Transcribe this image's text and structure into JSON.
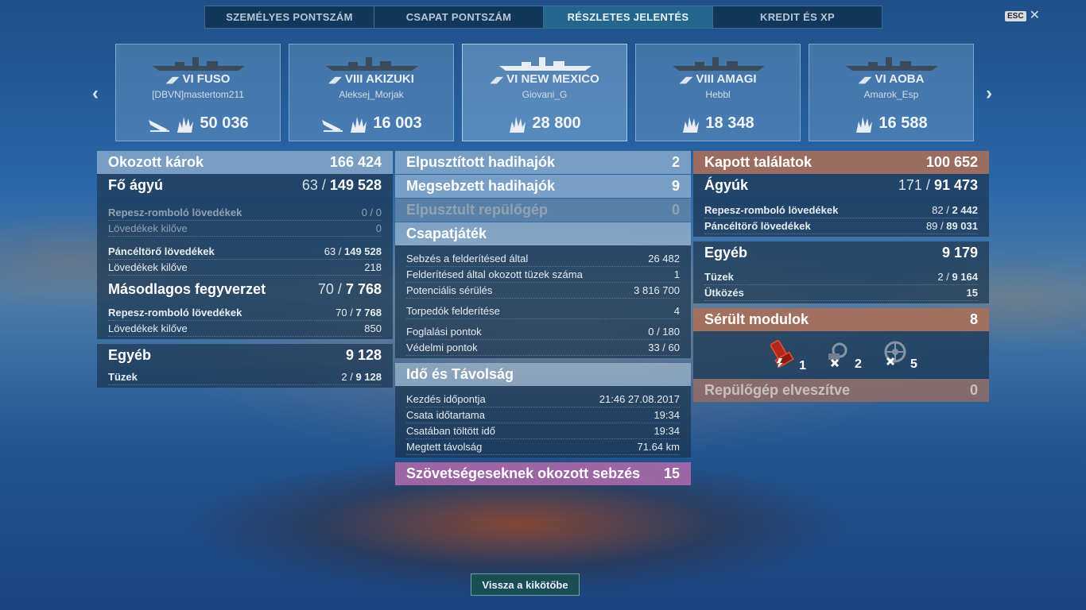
{
  "tabs": [
    "SZEMÉLYES PONTSZÁM",
    "CSAPAT PONTSZÁM",
    "RÉSZLETES JELENTÉS",
    "KREDIT ÉS XP"
  ],
  "active_tab": "RÉSZLETES JELENTÉS",
  "esc": {
    "key": "ESC",
    "close": "✕"
  },
  "arrows": {
    "left": "‹",
    "right": "›"
  },
  "cards": [
    {
      "tier": "VI",
      "ship": "FUSO",
      "player": "[DBVN]mastertom211",
      "score": "50 036"
    },
    {
      "tier": "VIII",
      "ship": "AKIZUKI",
      "player": "Aleksej_Morjak",
      "score": "16 003"
    },
    {
      "tier": "VI",
      "ship": "NEW MEXICO",
      "player": "Giovani_G",
      "score": "28 800"
    },
    {
      "tier": "VIII",
      "ship": "AMAGI",
      "player": "Hebbl",
      "score": "18 348"
    },
    {
      "tier": "VI",
      "ship": "AOBA",
      "player": "Amarok_Esp",
      "score": "16 588"
    }
  ],
  "damage": {
    "title": "Okozott károk",
    "total": "166 424",
    "main": {
      "title": "Fő ágyú",
      "hits": "63",
      "sep": "/",
      "shots": "149 528"
    },
    "he": {
      "label": "Repesz-romboló lövedékek",
      "value": "0 / 0"
    },
    "he_fired": {
      "label": "Lövedékek kilőve",
      "value": "0"
    },
    "ap": {
      "label": "Páncéltörő lövedékek",
      "hits": "63 / ",
      "dmg": "149 528"
    },
    "ap_fired": {
      "label": "Lövedékek kilőve",
      "value": "218"
    },
    "secondary": {
      "title": "Másodlagos fegyverzet",
      "hits": "70",
      "sep": "/",
      "dmg": "7 768"
    },
    "sec_he": {
      "label": "Repesz-romboló lövedékek",
      "hits": "70 / ",
      "dmg": "7 768"
    },
    "sec_fired": {
      "label": "Lövedékek kilőve",
      "value": "850"
    },
    "other": {
      "title": "Egyéb",
      "value": "9 128"
    },
    "fires": {
      "label": "Tüzek",
      "hits": "2 / ",
      "dmg": "9 128"
    }
  },
  "middle": {
    "destroyed": {
      "label": "Elpusztított hadihajók",
      "value": "2"
    },
    "damaged": {
      "label": "Megsebzett hadihajók",
      "value": "9"
    },
    "planes": {
      "label": "Elpusztult repülőgép",
      "value": "0"
    },
    "team": {
      "title": "Csapatjáték",
      "rows": [
        {
          "label": "Sebzés a felderítésed által",
          "value": "26 482"
        },
        {
          "label": "Felderítésed által okozott tüzek száma",
          "value": "1"
        },
        {
          "label": "Potenciális sérülés",
          "value": "3 816 700"
        },
        {
          "label": "Torpedók felderítése",
          "value": "4"
        },
        {
          "label": "Foglalási pontok",
          "value": "0 / 180"
        },
        {
          "label": "Védelmi pontok",
          "value": "33 / 60"
        }
      ]
    },
    "time": {
      "title": "Idő és Távolság",
      "rows": [
        {
          "label": "Kezdés időpontja",
          "value": "21:46  27.08.2017"
        },
        {
          "label": "Csata időtartama",
          "value": "19:34"
        },
        {
          "label": "Csatában töltött idő",
          "value": "19:34"
        },
        {
          "label": "Megtett távolság",
          "value": "71.64 km"
        }
      ]
    },
    "ally": {
      "label": "Szövetségeseknek okozott sebzés",
      "value": "15"
    }
  },
  "received": {
    "title": "Kapott találatok",
    "total": "100 652",
    "guns": {
      "title": "Ágyúk",
      "hits": "171",
      "sep": "/",
      "dmg": "91 473"
    },
    "he": {
      "label": "Repesz-romboló lövedékek",
      "hits": "82 / ",
      "dmg": "2 442"
    },
    "ap": {
      "label": "Páncéltörő lövedékek",
      "hits": "89 / ",
      "dmg": "89 031"
    },
    "other": {
      "title": "Egyéb",
      "value": "9 179"
    },
    "fires": {
      "label": "Tüzek",
      "hits": "2 / ",
      "dmg": "9 164"
    },
    "ram": {
      "label": "Ütközés",
      "value": "15"
    },
    "modules": {
      "title": "Sérült modulok",
      "value": "8",
      "items": [
        {
          "icon": "turret-icon",
          "count": "1"
        },
        {
          "icon": "engine-icon",
          "count": "2"
        },
        {
          "icon": "steering-icon",
          "count": "5"
        }
      ]
    },
    "planes_lost": {
      "label": "Repülőgép elveszítve",
      "value": "0"
    }
  },
  "back_button": "Vissza a kikötőbe"
}
